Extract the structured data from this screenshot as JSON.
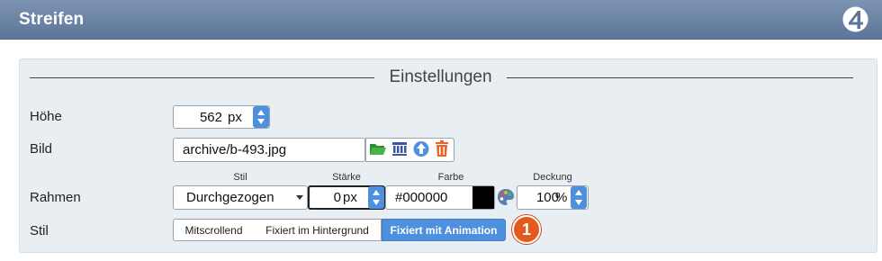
{
  "titlebar": {
    "title": "Streifen",
    "logo_icon": "circle-four-logo"
  },
  "section": {
    "legend": "Einstellungen"
  },
  "rows": {
    "hoehe": {
      "label": "Höhe",
      "value": "562",
      "unit": "px"
    },
    "bild": {
      "label": "Bild",
      "value": "archive/b-493.jpg",
      "icons": [
        "folder-icon",
        "grid-icon",
        "upload-icon",
        "trash-icon"
      ]
    },
    "rahmen": {
      "label": "Rahmen",
      "stil_label": "Stil",
      "stil_value": "Durchgezogen",
      "staerke_label": "Stärke",
      "staerke_value": "0",
      "staerke_unit": "px",
      "farbe_label": "Farbe",
      "farbe_value": "#000000",
      "farbe_swatch": "#000000",
      "deckung_label": "Deckung",
      "deckung_value": "100",
      "deckung_unit": "%"
    },
    "stil": {
      "label": "Stil",
      "options": [
        "Mitscrollend",
        "Fixiert im Hintergrund",
        "Fixiert mit Animation"
      ],
      "selected": "Fixiert mit Animation"
    }
  },
  "badge": "1",
  "colors": {
    "accent": "#4e90de",
    "titlebar": "#6a83a6",
    "badge": "#e35a1e",
    "panel": "#e9eef3"
  }
}
